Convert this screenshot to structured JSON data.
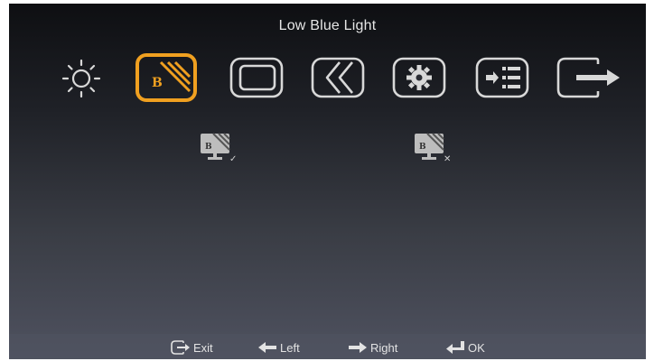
{
  "osd": {
    "title": "Low Blue Light",
    "accent_color": "#f0a020",
    "icon_color": "#d8d8d8",
    "menu_icons": [
      {
        "name": "brightness-icon",
        "selected": false
      },
      {
        "name": "low-blue-light-icon",
        "selected": true,
        "glyph": "B"
      },
      {
        "name": "image-properties-icon",
        "selected": false
      },
      {
        "name": "image-setup-icon",
        "selected": false
      },
      {
        "name": "options-icon",
        "selected": false
      },
      {
        "name": "input-signal-icon",
        "selected": false
      },
      {
        "name": "exit-icon",
        "selected": false
      }
    ],
    "options": [
      {
        "name": "low-blue-light-on-icon",
        "glyph": "B",
        "state_mark": "✓"
      },
      {
        "name": "low-blue-light-off-icon",
        "glyph": "B",
        "state_mark": "✕"
      }
    ],
    "footer": {
      "exit": "Exit",
      "left": "Left",
      "right": "Right",
      "ok": "OK"
    }
  }
}
